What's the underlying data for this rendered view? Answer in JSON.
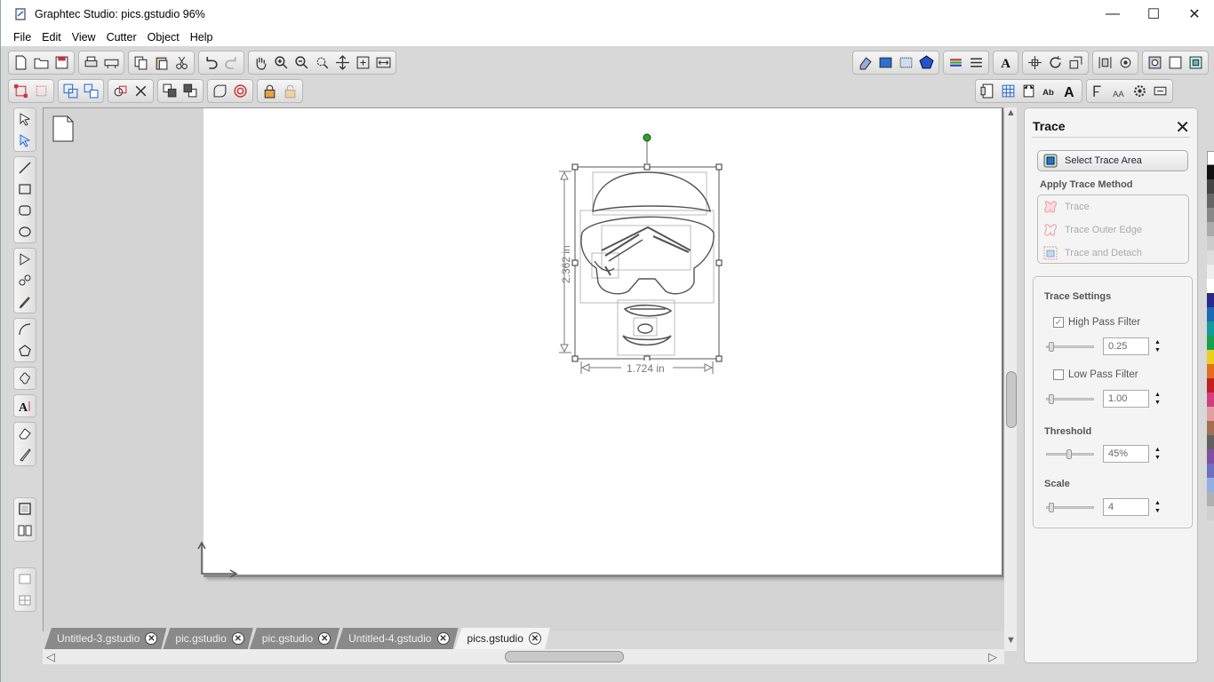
{
  "window": {
    "title": "Graphtec Studio: pics.gstudio 96%",
    "minimize": "—",
    "maximize": "☐",
    "close": "✕"
  },
  "menu": [
    "File",
    "Edit",
    "View",
    "Cutter",
    "Object",
    "Help"
  ],
  "canvas": {
    "width_label": "1.724 in",
    "height_label": "2.362 in"
  },
  "tabs": [
    {
      "label": "Untitled-3.gstudio",
      "active": false
    },
    {
      "label": "pic.gstudio",
      "active": false
    },
    {
      "label": "pic.gstudio",
      "active": false
    },
    {
      "label": "Untitled-4.gstudio",
      "active": false
    },
    {
      "label": "pics.gstudio",
      "active": true
    }
  ],
  "panel": {
    "title": "Trace",
    "select_trace_area": "Select Trace Area",
    "apply_method_label": "Apply Trace Method",
    "methods": [
      "Trace",
      "Trace Outer Edge",
      "Trace and Detach"
    ],
    "settings_label": "Trace Settings",
    "high_pass": {
      "label": "High Pass Filter",
      "checked": true,
      "value": "0.25"
    },
    "low_pass": {
      "label": "Low Pass Filter",
      "checked": false,
      "value": "1.00"
    },
    "threshold": {
      "label": "Threshold",
      "value": "45%"
    },
    "scale": {
      "label": "Scale",
      "value": "4"
    }
  },
  "colors": {
    "accent": "#2a6fd6",
    "selection_handle": "#22aa22"
  }
}
